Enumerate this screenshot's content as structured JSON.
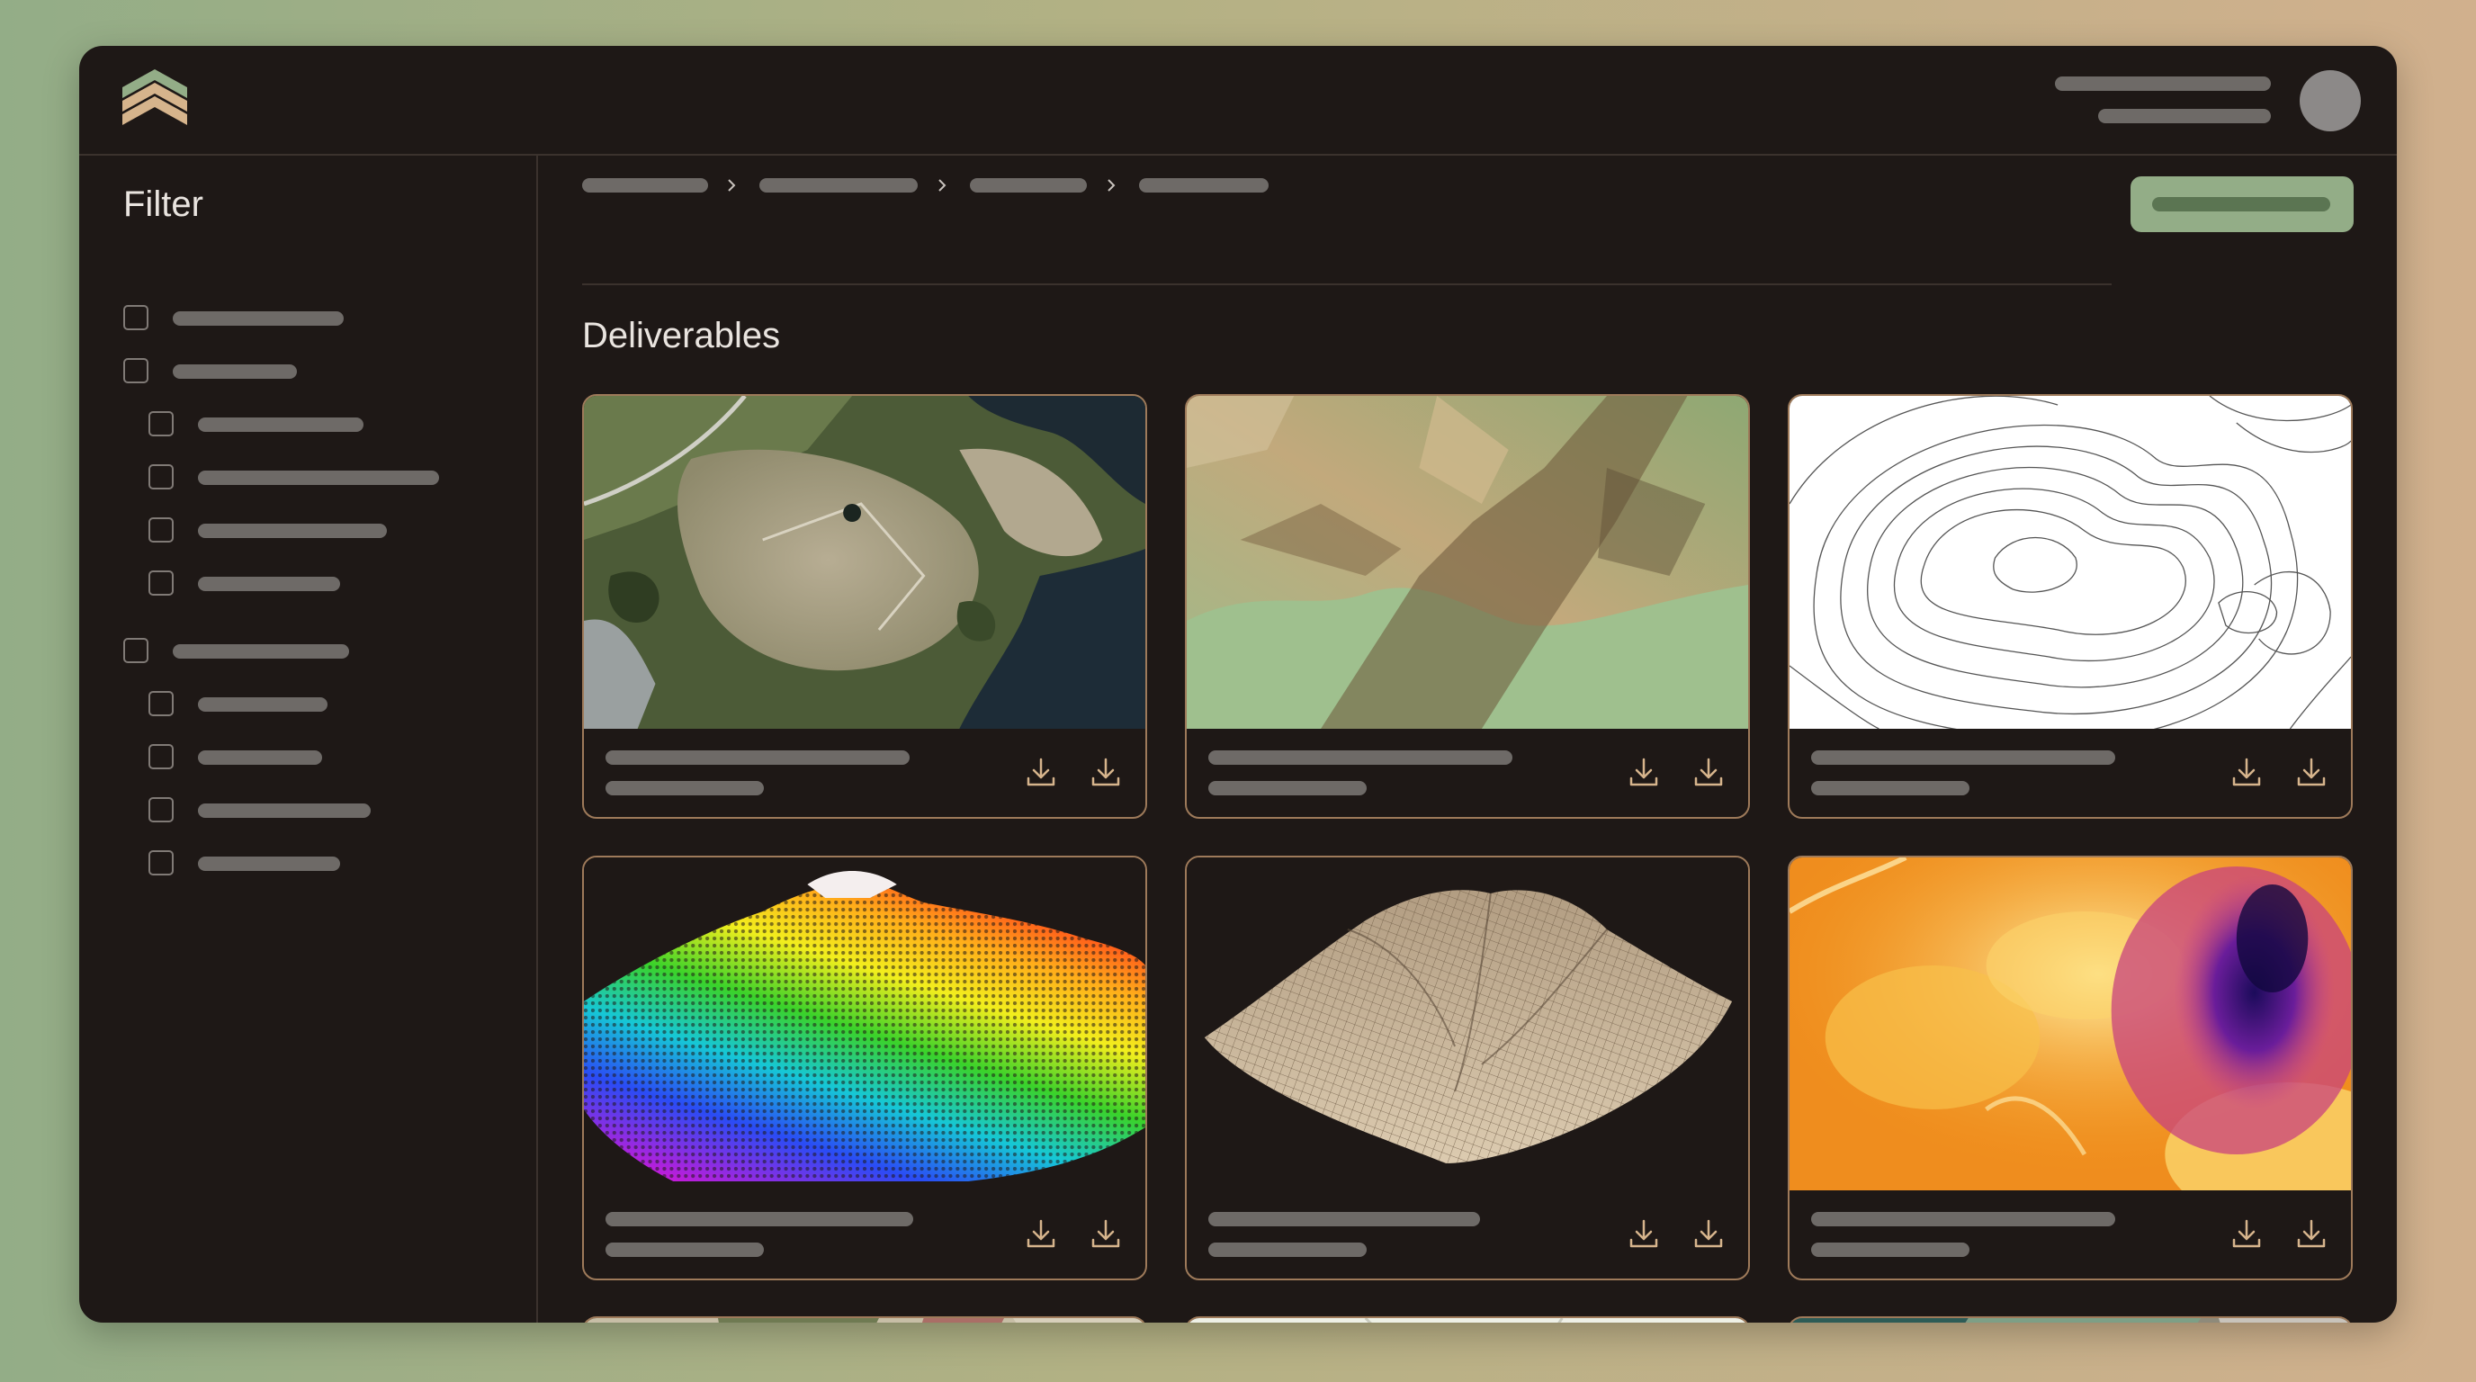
{
  "filter": {
    "title": "Filter"
  },
  "main": {
    "heading": "Deliverables"
  },
  "colors": {
    "accent": "#93ad87",
    "card_border": "#9e7a5a",
    "panel_bg": "#1e1816",
    "placeholder": "#6e6a67"
  },
  "icons": [
    "logo-icon",
    "chevron-right-icon",
    "download-icon",
    "avatar"
  ],
  "cards": [
    {
      "thumbnail": "aerial-satellite-imagery"
    },
    {
      "thumbnail": "hillshade-elevation-map"
    },
    {
      "thumbnail": "contour-lines-map"
    },
    {
      "thumbnail": "rainbow-point-cloud-3d"
    },
    {
      "thumbnail": "wireframe-terrain-mesh-3d"
    },
    {
      "thumbnail": "thermal-heatmap"
    },
    {
      "thumbnail": "aerial-imagery-partial"
    },
    {
      "thumbnail": "street-map-partial"
    },
    {
      "thumbnail": "aerial-imagery-partial"
    }
  ]
}
